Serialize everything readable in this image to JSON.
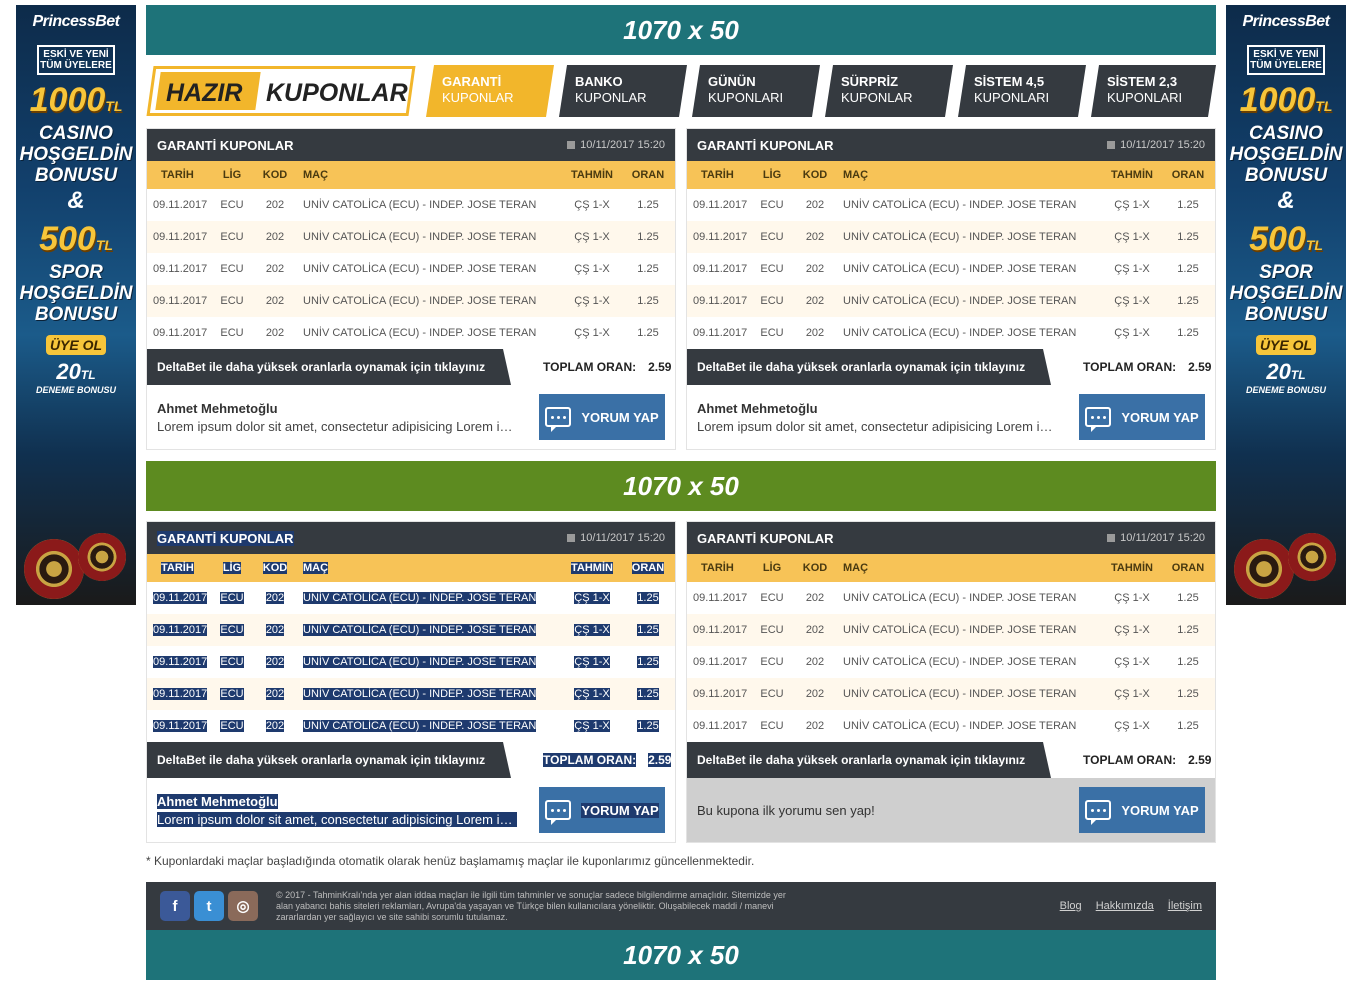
{
  "ads": {
    "left": {
      "logo": "PrincessBet",
      "tagline": "ESKİ VE YENİ TÜM ÜYELERE",
      "casino_amount": "1000",
      "casino_unit": "TL",
      "casino_words": [
        "CASINO",
        "HOŞGELDİN",
        "BONUSU"
      ],
      "amp": "&",
      "spor_amount": "500",
      "spor_unit": "TL",
      "spor_words": [
        "SPOR",
        "HOŞGELDİN",
        "BONUSU"
      ],
      "join": "ÜYE OL",
      "trial_amount": "20",
      "trial_unit": "TL",
      "trial_label": "DENEME BONUSU"
    }
  },
  "banners": {
    "top": "1070 x 50",
    "middle": "1070 x 50",
    "bottom": "1070 x 50"
  },
  "nav": {
    "logo_left": "HAZIR",
    "logo_right": "KUPONLAR",
    "tabs": [
      {
        "main": "GARANTİ",
        "sub": "KUPONLAR",
        "active": true
      },
      {
        "main": "BANKO",
        "sub": "KUPONLAR",
        "active": false
      },
      {
        "main": "GÜNÜN",
        "sub": "KUPONLARI",
        "active": false
      },
      {
        "main": "SÜRPRİZ",
        "sub": "KUPONLAR",
        "active": false
      },
      {
        "main": "SİSTEM 4,5",
        "sub": "KUPONLARI",
        "active": false
      },
      {
        "main": "SİSTEM 2,3",
        "sub": "KUPONLARI",
        "active": false
      }
    ]
  },
  "coupon": {
    "title": "GARANTİ KUPONLAR",
    "date": "10/11/2017 15:20",
    "columns": {
      "date": "TARİH",
      "league": "LİG",
      "code": "KOD",
      "match": "MAÇ",
      "prediction": "TAHMİN",
      "odds": "ORAN"
    },
    "rows": [
      {
        "date": "09.11.2017",
        "league": "ECU",
        "code": "202",
        "match": "UNİV CATOLİCA (ECU) - INDEP. JOSE TERAN",
        "prediction": "ÇŞ 1-X",
        "odds": "1.25"
      },
      {
        "date": "09.11.2017",
        "league": "ECU",
        "code": "202",
        "match": "UNİV CATOLİCA (ECU) - INDEP. JOSE TERAN",
        "prediction": "ÇŞ 1-X",
        "odds": "1.25"
      },
      {
        "date": "09.11.2017",
        "league": "ECU",
        "code": "202",
        "match": "UNİV CATOLİCA (ECU) - INDEP. JOSE TERAN",
        "prediction": "ÇŞ 1-X",
        "odds": "1.25"
      },
      {
        "date": "09.11.2017",
        "league": "ECU",
        "code": "202",
        "match": "UNİV CATOLİCA (ECU) - INDEP. JOSE TERAN",
        "prediction": "ÇŞ 1-X",
        "odds": "1.25"
      },
      {
        "date": "09.11.2017",
        "league": "ECU",
        "code": "202",
        "match": "UNİV CATOLİCA (ECU) - INDEP. JOSE TERAN",
        "prediction": "ÇŞ 1-X",
        "odds": "1.25"
      }
    ],
    "promo": "DeltaBet ile daha yüksek oranlarla oynamak için tıklayınız",
    "total_label": "TOPLAM ORAN:",
    "total_value": "2.59",
    "commenter": "Ahmet Mehmetoğlu",
    "comment": "Lorem ipsum dolor sit amet, consectetur adipisicing Lorem ipsum dolor sit amet",
    "empty_comment": "Bu kupona ilk yorumu sen yap!",
    "button": "YORUM YAP"
  },
  "note": "* Kuponlardaki maçlar başladığında otomatik olarak henüz başlamamış maçlar ile kuponlarımız güncellenmektedir.",
  "footer": {
    "social": [
      "f",
      "t",
      "◎"
    ],
    "text": "© 2017 - TahminKralı'nda yer alan iddaa maçları ile ilgili tüm tahminler ve sonuçlar sadece bilgilendirme amaçlıdır. Sitemizde yer alan yabancı bahis siteleri reklamları, Avrupa'da yaşayan ve Türkçe bilen kullanıcılara yöneliktir. Oluşabilecek maddi / manevi zararlardan yer sağlayıcı ve site sahibi sorumlu tutulamaz.",
    "links": [
      "Blog",
      "Hakkımızda",
      "İletişim"
    ]
  },
  "colors": {
    "dark": "#353a40",
    "accent": "#f2b62b",
    "teal": "#1e7379",
    "green": "#5d8b20",
    "button": "#3a70a6"
  }
}
